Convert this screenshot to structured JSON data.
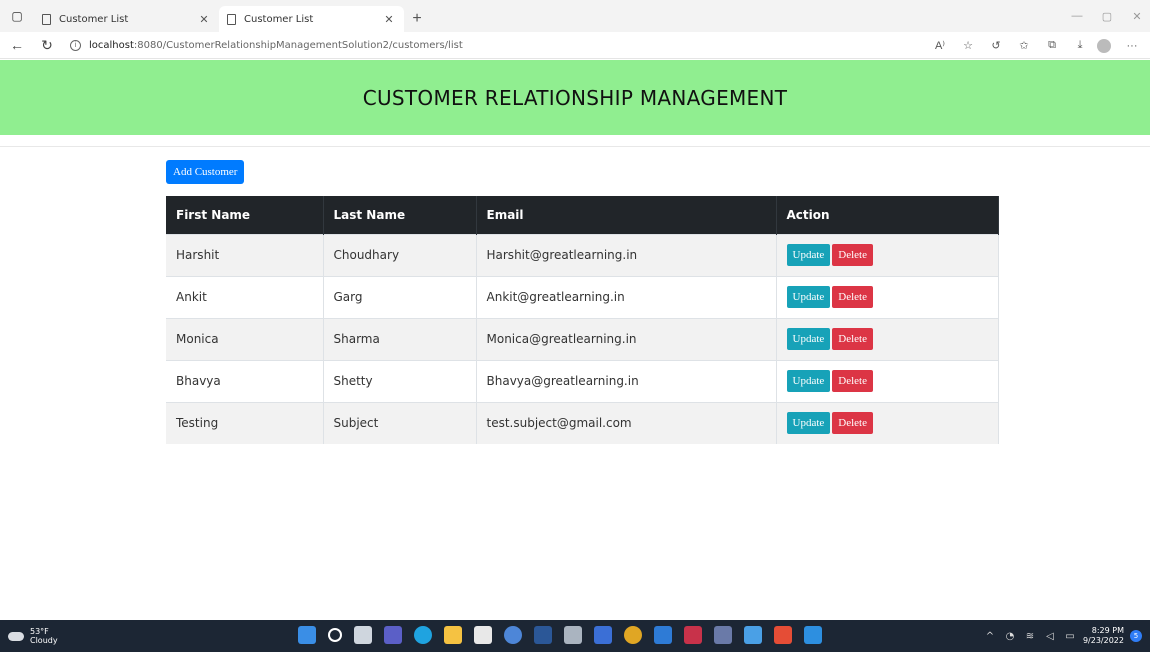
{
  "browser": {
    "tabs": [
      {
        "title": "Customer List",
        "active": false
      },
      {
        "title": "Customer List",
        "active": true
      }
    ],
    "url_host": "localhost",
    "url_path": ":8080/CustomerRelationshipManagementSolution2/customers/list"
  },
  "page": {
    "header_title": "CUSTOMER RELATIONSHIP MANAGEMENT",
    "add_button_label": "Add Customer"
  },
  "table": {
    "headers": [
      "First Name",
      "Last Name",
      "Email",
      "Action"
    ],
    "rows": [
      {
        "first": "Harshit",
        "last": "Choudhary",
        "email": "Harshit@greatlearning.in"
      },
      {
        "first": "Ankit",
        "last": "Garg",
        "email": "Ankit@greatlearning.in"
      },
      {
        "first": "Monica",
        "last": "Sharma",
        "email": "Monica@greatlearning.in"
      },
      {
        "first": "Bhavya",
        "last": "Shetty",
        "email": "Bhavya@greatlearning.in"
      },
      {
        "first": "Testing",
        "last": "Subject",
        "email": "test.subject@gmail.com"
      }
    ],
    "update_label": "Update",
    "delete_label": "Delete"
  },
  "taskbar": {
    "weather_temp": "53°F",
    "weather_desc": "Cloudy",
    "time": "8:29 PM",
    "date": "9/23/2022",
    "notification_count": "5"
  },
  "colors": {
    "header_bg": "#90ee90",
    "table_head_bg": "#212529",
    "primary": "#007bff",
    "update": "#17a2b8",
    "delete": "#dc3545"
  }
}
